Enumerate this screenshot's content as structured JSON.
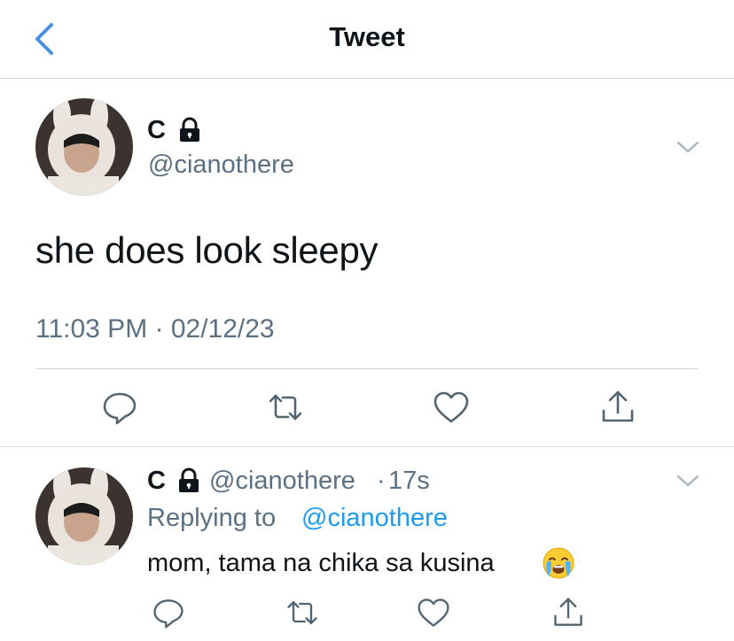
{
  "header": {
    "title": "Tweet",
    "back_icon": "chevron-left-icon"
  },
  "main_tweet": {
    "display_name": "C",
    "handle": "@cianothere",
    "text": "she does look sleepy",
    "timestamp": "11:03 PM · 02/12/23",
    "protected_icon": "lock-icon",
    "actions": [
      "reply-icon",
      "retweet-icon",
      "like-icon",
      "share-icon"
    ]
  },
  "reply_tweet": {
    "display_name": "C",
    "handle": "@cianothere",
    "separator": "·",
    "time_ago": "17s",
    "replying_to_prefix": "Replying to",
    "replying_to_handle": "@cianothere",
    "text": "mom, tama na chika sa kusina",
    "emoji": "loudly-crying-face",
    "actions": [
      "reply-icon",
      "retweet-icon",
      "like-icon",
      "share-icon"
    ]
  },
  "colors": {
    "accent": "#1d9bf0",
    "back_arrow": "#4a90e2",
    "secondary_text": "#5b7083",
    "divider": "#d6d9db",
    "icon": "#536471"
  }
}
